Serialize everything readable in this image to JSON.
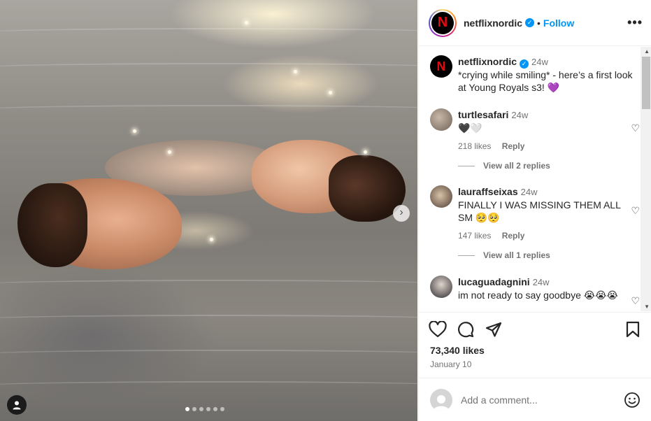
{
  "post": {
    "username": "netflixnordic",
    "follow_label": "Follow",
    "separator": "•",
    "more_label": "•••",
    "logo_letter": "N",
    "verified_mark": "✓"
  },
  "caption": {
    "username": "netflixnordic",
    "time": "24w",
    "text": "*crying while smiling* - here’s a first look at Young Royals s3! 💜"
  },
  "comments": [
    {
      "username": "turtlesafari",
      "time": "24w",
      "text": "🖤🤍",
      "likes": "218 likes",
      "reply": "Reply",
      "view_replies": "View all 2 replies"
    },
    {
      "username": "lauraffseixas",
      "time": "24w",
      "text": "FINALLY I WAS MISSING THEM ALL SM 🥺🥺",
      "likes": "147 likes",
      "reply": "Reply",
      "view_replies": "View all 1 replies"
    },
    {
      "username": "lucaguadagnini",
      "time": "24w",
      "text": "im not ready to say goodbye 😭😭😭"
    }
  ],
  "stats": {
    "likes": "73,340 likes",
    "date": "January 10"
  },
  "add_comment": {
    "placeholder": "Add a comment..."
  },
  "carousel": {
    "next_glyph": "›",
    "slide_count": 6,
    "active_index": 0
  },
  "icons": [
    "heart-icon",
    "comment-icon",
    "share-icon",
    "bookmark-icon",
    "emoji-icon",
    "user-tag-icon"
  ],
  "colors": {
    "accent": "#0095f6",
    "text": "#262626",
    "muted": "#737373",
    "netflix_red": "#e50914"
  }
}
